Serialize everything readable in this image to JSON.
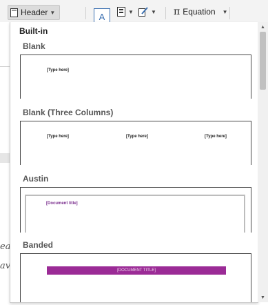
{
  "ribbon": {
    "header_label": "Header",
    "equation_label": "Equation",
    "equation_symbol": "π",
    "text_box_letter": "A"
  },
  "doc_strip": {
    "script_line_1": "ea",
    "script_line_2": "av"
  },
  "gallery": {
    "section_title": "Built-in",
    "items": [
      {
        "label": "Blank",
        "placeholders": [
          "[Type here]"
        ]
      },
      {
        "label": "Blank (Three Columns)",
        "placeholders": [
          "[Type here]",
          "[Type here]",
          "[Type here]"
        ]
      },
      {
        "label": "Austin",
        "placeholders": [
          "[Document title]"
        ]
      },
      {
        "label": "Banded",
        "placeholders": [
          "[DOCUMENT TITLE]"
        ]
      }
    ]
  },
  "scrollbar": {
    "position_fraction": 0.05
  },
  "colors": {
    "banded_bar": "#9b2b96",
    "austin_text": "#7b2f8e",
    "accent_blue": "#3a6fb0"
  }
}
